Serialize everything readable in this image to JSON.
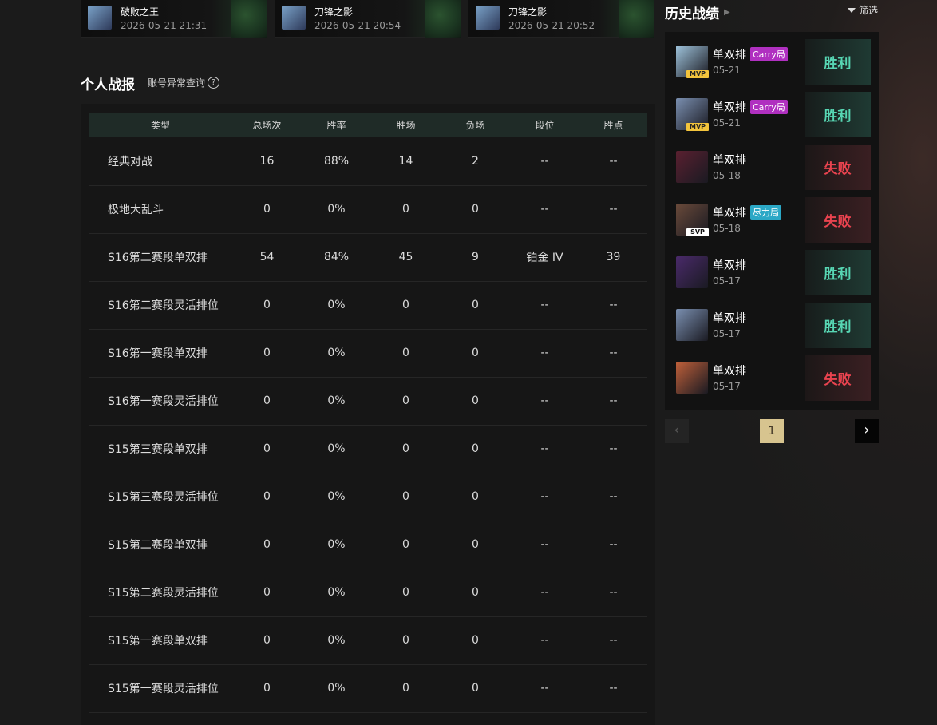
{
  "recent_games": [
    {
      "hero": "破败之王",
      "time": "2026-05-21 21:31"
    },
    {
      "hero": "刀锋之影",
      "time": "2026-05-21 20:54"
    },
    {
      "hero": "刀锋之影",
      "time": "2026-05-21 20:52"
    }
  ],
  "personal_stats": {
    "title": "个人战报",
    "account_check_link": "账号异常查询",
    "help_icon": "?",
    "columns": [
      "类型",
      "总场次",
      "胜率",
      "胜场",
      "负场",
      "段位",
      "胜点"
    ],
    "rows": [
      [
        "经典对战",
        "16",
        "88%",
        "14",
        "2",
        "--",
        "--"
      ],
      [
        "极地大乱斗",
        "0",
        "0%",
        "0",
        "0",
        "--",
        "--"
      ],
      [
        "S16第二赛段单双排",
        "54",
        "84%",
        "45",
        "9",
        "铂金 IV",
        "39"
      ],
      [
        "S16第二赛段灵活排位",
        "0",
        "0%",
        "0",
        "0",
        "--",
        "--"
      ],
      [
        "S16第一赛段单双排",
        "0",
        "0%",
        "0",
        "0",
        "--",
        "--"
      ],
      [
        "S16第一赛段灵活排位",
        "0",
        "0%",
        "0",
        "0",
        "--",
        "--"
      ],
      [
        "S15第三赛段单双排",
        "0",
        "0%",
        "0",
        "0",
        "--",
        "--"
      ],
      [
        "S15第三赛段灵活排位",
        "0",
        "0%",
        "0",
        "0",
        "--",
        "--"
      ],
      [
        "S15第二赛段单双排",
        "0",
        "0%",
        "0",
        "0",
        "--",
        "--"
      ],
      [
        "S15第二赛段灵活排位",
        "0",
        "0%",
        "0",
        "0",
        "--",
        "--"
      ],
      [
        "S15第一赛段单双排",
        "0",
        "0%",
        "0",
        "0",
        "--",
        "--"
      ],
      [
        "S15第一赛段灵活排位",
        "0",
        "0%",
        "0",
        "0",
        "--",
        "--"
      ]
    ]
  },
  "history": {
    "title": "历史战绩",
    "filter_label": "筛选",
    "matches": [
      {
        "mode": "单双排",
        "tag": "Carry局",
        "tag_type": "carry",
        "badge": "MVP",
        "date": "05-21",
        "result": "胜利",
        "result_type": "win",
        "avatar_color": "#9fc4dc"
      },
      {
        "mode": "单双排",
        "tag": "Carry局",
        "tag_type": "carry",
        "badge": "MVP",
        "date": "05-21",
        "result": "胜利",
        "result_type": "win",
        "avatar_color": "#7a8fb0"
      },
      {
        "mode": "单双排",
        "tag": "",
        "tag_type": "",
        "badge": "",
        "date": "05-18",
        "result": "失败",
        "result_type": "lose",
        "avatar_color": "#5a2030"
      },
      {
        "mode": "单双排",
        "tag": "尽力局",
        "tag_type": "effort",
        "badge": "SVP",
        "date": "05-18",
        "result": "失败",
        "result_type": "lose",
        "avatar_color": "#6a4a3a"
      },
      {
        "mode": "单双排",
        "tag": "",
        "tag_type": "",
        "badge": "",
        "date": "05-17",
        "result": "胜利",
        "result_type": "win",
        "avatar_color": "#4a2a6a"
      },
      {
        "mode": "单双排",
        "tag": "",
        "tag_type": "",
        "badge": "",
        "date": "05-17",
        "result": "胜利",
        "result_type": "win",
        "avatar_color": "#7a8fb0"
      },
      {
        "mode": "单双排",
        "tag": "",
        "tag_type": "",
        "badge": "",
        "date": "05-17",
        "result": "失败",
        "result_type": "lose",
        "avatar_color": "#c0603a"
      }
    ]
  },
  "pagination": {
    "prev": "‹",
    "current_page": "1",
    "next": "›"
  }
}
